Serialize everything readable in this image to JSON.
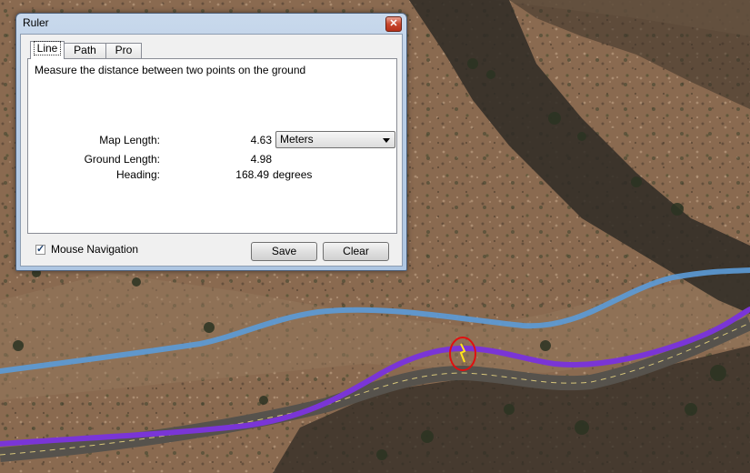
{
  "dialog": {
    "title": "Ruler",
    "close_label": "✕",
    "tabs": [
      {
        "label": "Line",
        "active": true
      },
      {
        "label": "Path",
        "active": false
      },
      {
        "label": "Pro",
        "active": false
      }
    ],
    "description": "Measure the distance between two points on the ground",
    "map_length": {
      "label": "Map Length:",
      "value": "4.63",
      "unit": "Meters"
    },
    "ground_length": {
      "label": "Ground Length:",
      "value": "4.98"
    },
    "heading": {
      "label": "Heading:",
      "value": "168.49",
      "unit": "degrees"
    },
    "mouse_navigation": {
      "label": "Mouse Navigation",
      "checked": true
    },
    "buttons": {
      "save": "Save",
      "clear": "Clear"
    }
  },
  "map": {
    "colors": {
      "terrain": "#8a6a50",
      "shadow": "#2e2a24",
      "road": "#56524c",
      "path_blue": "#5b9bd8",
      "path_purple": "#7a35d6",
      "marker_red": "#e01010",
      "marker_yellow": "#ffe51a"
    }
  }
}
